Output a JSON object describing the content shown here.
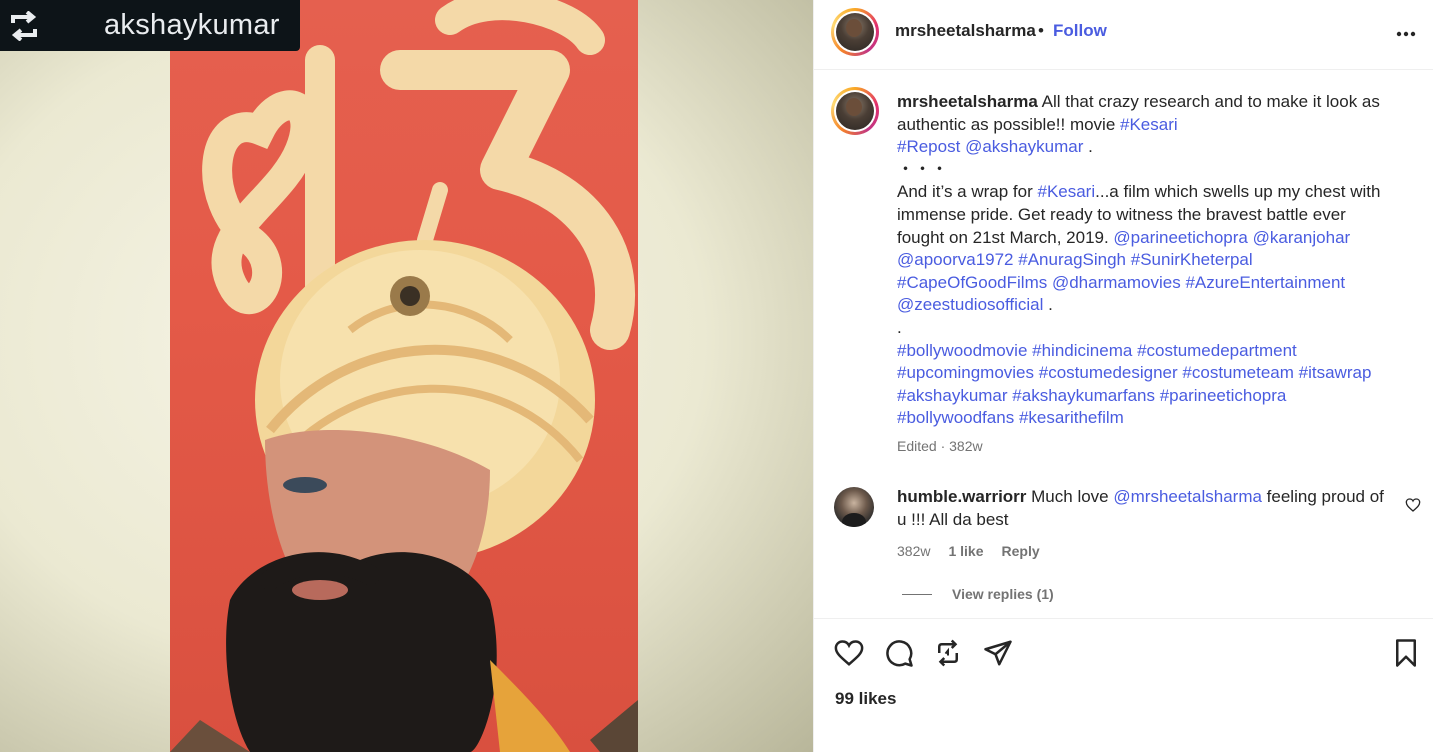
{
  "media": {
    "repost_username": "akshaykumar"
  },
  "header": {
    "username": "mrsheetalsharma",
    "separator": "•",
    "follow_label": "Follow"
  },
  "caption": {
    "username": "mrsheetalsharma",
    "lines": [
      [
        {
          "t": " All that crazy research and to make it look as authentic as possible!! movie "
        },
        {
          "tag": "#Kesari"
        }
      ],
      [
        {
          "tag": "#Repost"
        },
        {
          "t": " "
        },
        {
          "tag": "@akshaykumar"
        },
        {
          "t": " ."
        }
      ],
      [
        {
          "t": "・・・"
        }
      ],
      [
        {
          "t": "And it’s a wrap for "
        },
        {
          "tag": "#Kesari"
        },
        {
          "t": "...a film which swells up my chest with immense pride. Get ready to witness the bravest battle ever fought on 21st March, 2019. "
        },
        {
          "tag": "@parineetichopra"
        },
        {
          "t": " "
        },
        {
          "tag": "@karanjohar"
        },
        {
          "t": " "
        },
        {
          "tag": "@apoorva1972"
        },
        {
          "t": " "
        },
        {
          "tag": "#AnuragSingh"
        },
        {
          "t": " "
        },
        {
          "tag": "#SunirKheterpal"
        },
        {
          "t": " "
        },
        {
          "tag": "#CapeOfGoodFilms"
        },
        {
          "t": " "
        },
        {
          "tag": "@dharmamovies"
        },
        {
          "t": " "
        },
        {
          "tag": "#AzureEntertainment"
        },
        {
          "t": " "
        },
        {
          "tag": "@zeestudiosofficial"
        },
        {
          "t": " ."
        }
      ],
      [
        {
          "t": "."
        }
      ],
      [
        {
          "tag": "#bollywoodmovie"
        },
        {
          "t": " "
        },
        {
          "tag": "#hindicinema"
        },
        {
          "t": " "
        },
        {
          "tag": "#costumedepartment"
        },
        {
          "t": " "
        },
        {
          "tag": "#upcomingmovies"
        },
        {
          "t": " "
        },
        {
          "tag": "#costumedesigner"
        },
        {
          "t": " "
        },
        {
          "tag": "#costumeteam"
        },
        {
          "t": " "
        },
        {
          "tag": "#itsawrap"
        },
        {
          "t": " "
        },
        {
          "tag": "#akshaykumar"
        },
        {
          "t": " "
        },
        {
          "tag": "#akshaykumarfans"
        },
        {
          "t": " "
        },
        {
          "tag": "#parineetichopra"
        },
        {
          "t": " "
        },
        {
          "tag": "#bollywoodfans"
        },
        {
          "t": " "
        },
        {
          "tag": "#kesarithefilm"
        }
      ]
    ],
    "meta": "Edited · 382w"
  },
  "comment": {
    "username": "humble.warriorr",
    "text_before": " Much love ",
    "mention": "@mrsheetalsharma",
    "text_after": " feeling proud of u !!! All da best",
    "time": "382w",
    "likes": "1 like",
    "reply_label": "Reply",
    "view_replies": "View replies (1)"
  },
  "footer": {
    "likes": "99 likes"
  },
  "icons": {
    "repost": "repost-icon",
    "more": "more-options-icon",
    "like": "heart-icon",
    "comment": "comment-icon",
    "share_repost": "repost-icon",
    "send": "send-icon",
    "save": "bookmark-icon"
  },
  "colors": {
    "link": "#4a5ce0",
    "muted": "#737373",
    "text": "#262626"
  }
}
